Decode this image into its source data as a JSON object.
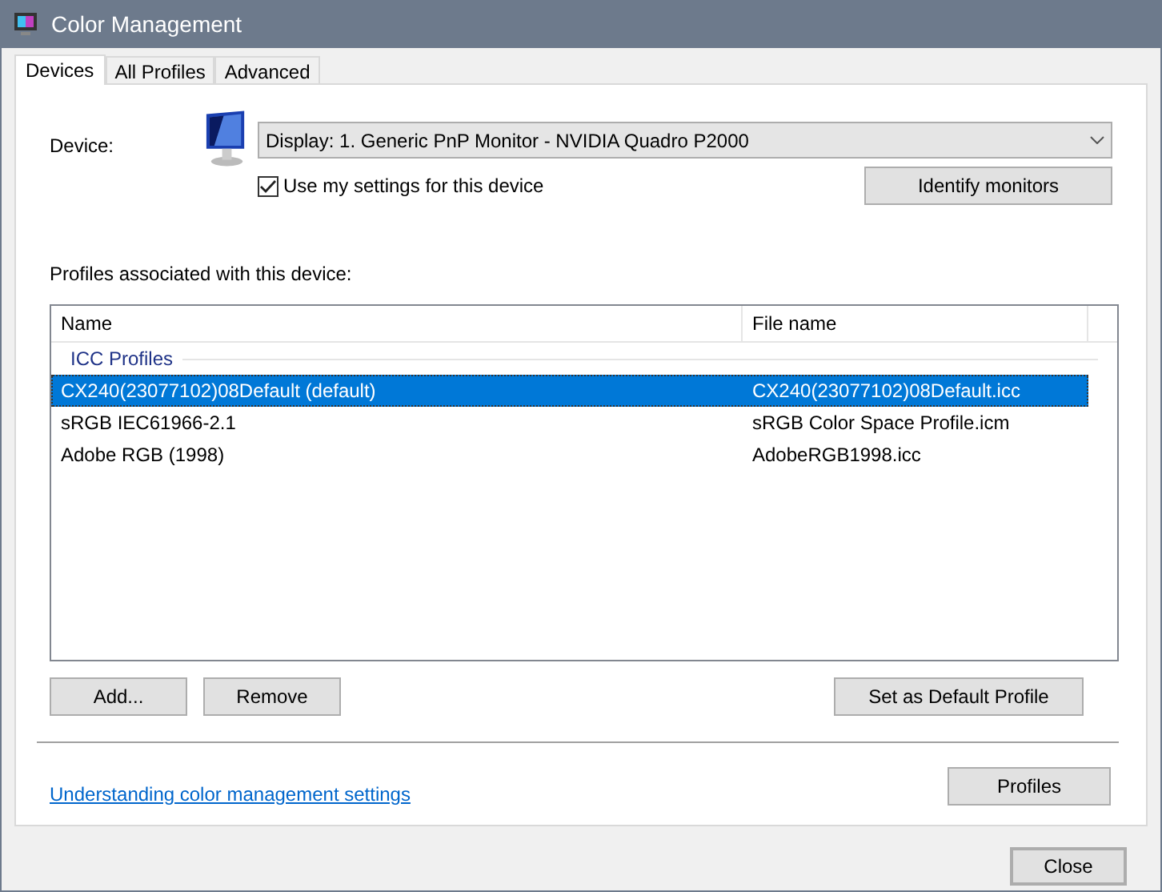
{
  "window": {
    "title": "Color Management"
  },
  "tabs": [
    {
      "label": "Devices",
      "selected": true
    },
    {
      "label": "All Profiles",
      "selected": false
    },
    {
      "label": "Advanced",
      "selected": false
    }
  ],
  "device": {
    "label": "Device:",
    "value": "Display: 1. Generic PnP Monitor - NVIDIA Quadro P2000",
    "use_my_settings": {
      "label": "Use my settings for this device",
      "checked": true
    },
    "identify_button": "Identify monitors"
  },
  "profiles": {
    "label": "Profiles associated with this device:",
    "columns": [
      "Name",
      "File name"
    ],
    "group": "ICC Profiles",
    "rows": [
      {
        "name": "CX240(23077102)08Default (default)",
        "file": "CX240(23077102)08Default.icc",
        "selected": true
      },
      {
        "name": "sRGB IEC61966-2.1",
        "file": "sRGB Color Space Profile.icm",
        "selected": false
      },
      {
        "name": "Adobe RGB (1998)",
        "file": "AdobeRGB1998.icc",
        "selected": false
      }
    ]
  },
  "buttons": {
    "add": "Add...",
    "remove": "Remove",
    "set_default": "Set as Default Profile",
    "profiles": "Profiles"
  },
  "link": "Understanding color management settings",
  "close": "Close"
}
